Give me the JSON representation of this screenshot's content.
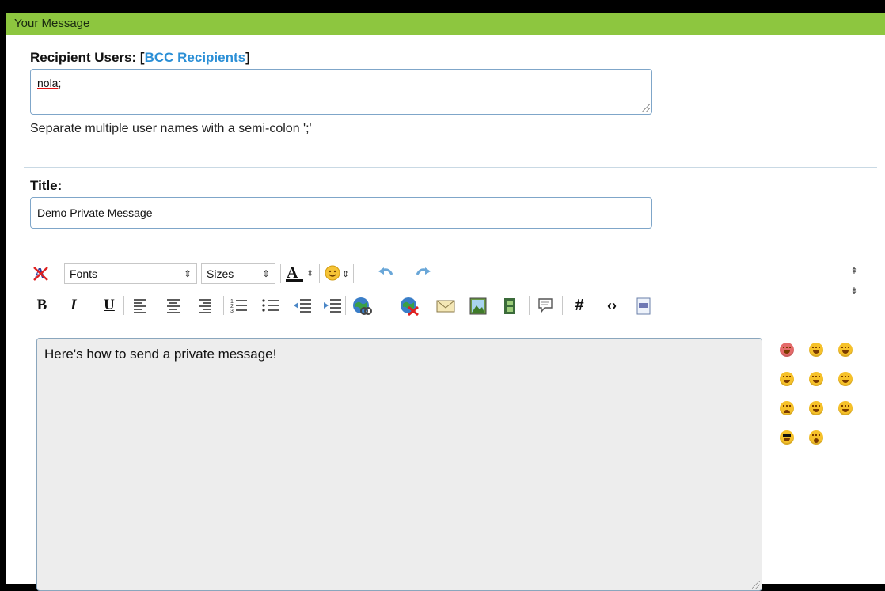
{
  "panel": {
    "title": "Your Message"
  },
  "recipients": {
    "label": "Recipient Users:",
    "bracket_open": "[",
    "bcc_link": "BCC Recipients",
    "bracket_close": "]",
    "value_name": "nola",
    "value_suffix": ";",
    "hint": "Separate multiple user names with a semi-colon ';'"
  },
  "title_field": {
    "label": "Title:",
    "value": "Demo Private Message"
  },
  "toolbar": {
    "fonts_label": "Fonts",
    "sizes_label": "Sizes",
    "row1_icons": [
      "remove-format-icon",
      "font-select",
      "size-select",
      "text-color-icon",
      "emoticon-picker-icon",
      "undo-icon",
      "redo-icon"
    ],
    "row2_icons": [
      "bold-icon",
      "italic-icon",
      "underline-icon",
      "align-left-icon",
      "align-center-icon",
      "align-right-icon",
      "numbered-list-icon",
      "bullet-list-icon",
      "outdent-icon",
      "indent-icon",
      "insert-link-icon",
      "remove-link-icon",
      "email-icon",
      "image-icon",
      "video-icon",
      "quote-icon",
      "hash-icon",
      "code-icon",
      "php-icon"
    ]
  },
  "editor": {
    "content": "Here's how to send a private message!"
  },
  "emoticons": [
    "angry",
    "tongue",
    "grin",
    "laugh",
    "smile",
    "happy",
    "sad",
    "confused",
    "wink",
    "cool",
    "surprised"
  ],
  "colors": {
    "header_bg": "#8dc63f",
    "link": "#2b8fd6",
    "editor_bg": "#ededed"
  }
}
